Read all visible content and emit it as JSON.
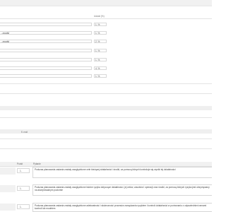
{
  "form": {
    "header_percent": "Udział (%)",
    "rows": [
      {
        "label": "",
        "percent": "1, %"
      },
      {
        "label": "...ovody)",
        "percent": "1, %"
      },
      {
        "label": "...ovody)",
        "percent": "2, %"
      },
      {
        "label": "",
        "percent": "1, %"
      },
      {
        "label": "",
        "percent": "1, %"
      },
      {
        "label": "",
        "percent": "4, %"
      },
      {
        "label": "",
        "percent": "1, %"
      }
    ]
  },
  "contact": {
    "email_label": "E-mail"
  },
  "table": {
    "headers": {
      "num": "Punkt",
      "question": "Pytanie"
    },
    "rows": [
      {
        "num": "1.",
        "text": "Podczas planowania zadania zostały uwzględnione cele bieżącej działalności i środki, za pomocą których kontroluje się wyniki tej działalności"
      },
      {
        "num": "1.",
        "text": "Podczas planowania zadania zostały uwzględnione istotne ryzyka dotyczące działalności, jej celów, zasobów i operacji oraz środki, za pomocą których ryzyka jest utrzymywany na akceptowalnym poziomie"
      },
      {
        "num": "1.",
        "text": "Podczas planowania zadania zostały uwzględnione adekwatność i skuteczność procesów zarządzania ryzykiem i kontroli działalności w porównaniu z odpowiednimi ramami kontroli lub modelem"
      }
    ]
  }
}
